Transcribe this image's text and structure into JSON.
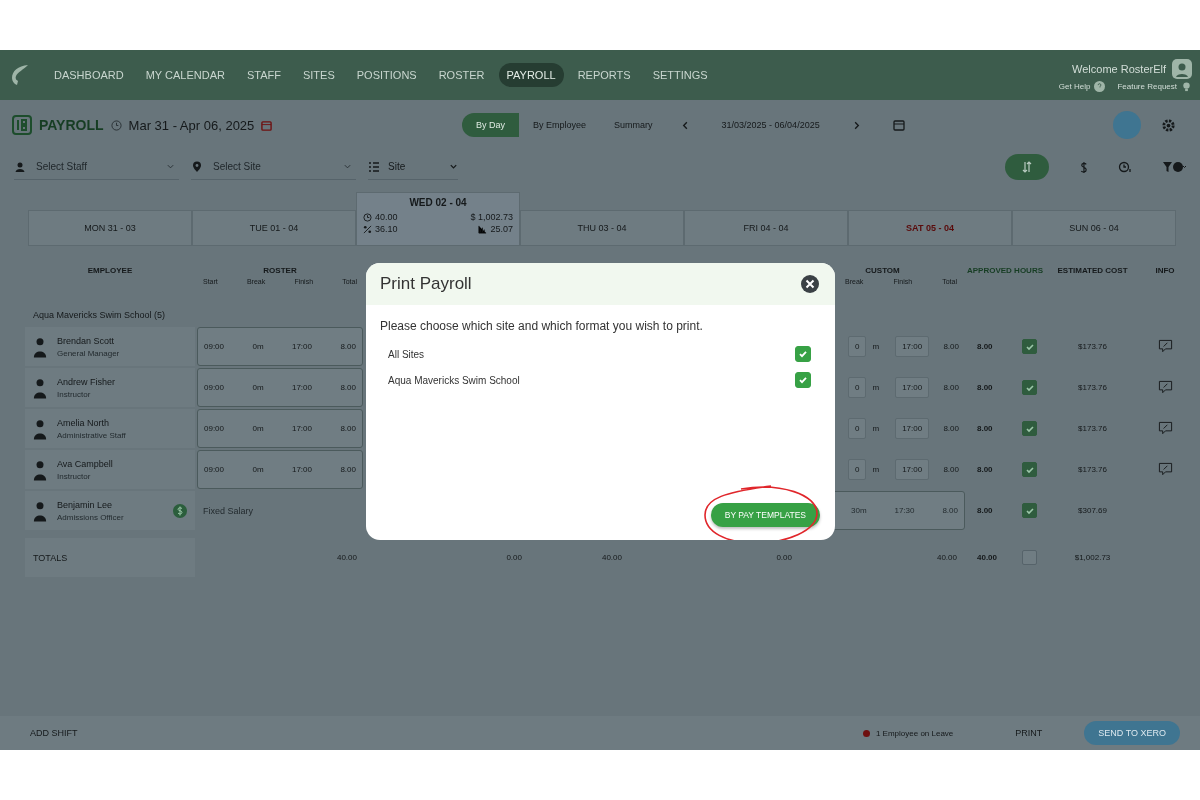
{
  "nav": {
    "items": [
      {
        "label": "DASHBOARD",
        "selected": false
      },
      {
        "label": "MY CALENDAR",
        "selected": false
      },
      {
        "label": "STAFF",
        "selected": false
      },
      {
        "label": "SITES",
        "selected": false
      },
      {
        "label": "POSITIONS",
        "selected": false
      },
      {
        "label": "ROSTER",
        "selected": false
      },
      {
        "label": "PAYROLL",
        "selected": true
      },
      {
        "label": "REPORTS",
        "selected": false
      },
      {
        "label": "SETTINGS",
        "selected": false
      }
    ],
    "welcome": "Welcome RosterElf",
    "help": "Get Help",
    "feature_request": "Feature Request"
  },
  "header": {
    "title": "PAYROLL",
    "date_range": "Mar 31 - Apr 06, 2025",
    "period": "31/03/2025 - 06/04/2025",
    "views": [
      {
        "label": "By Day",
        "selected": true
      },
      {
        "label": "By Employee",
        "selected": false
      },
      {
        "label": "Summary",
        "selected": false
      }
    ]
  },
  "filters": {
    "staff": {
      "placeholder": "Select Staff"
    },
    "site": {
      "placeholder": "Select Site"
    },
    "group_by": "Site"
  },
  "days": [
    {
      "label": "MON 31 - 03",
      "selected": false,
      "flagged": false
    },
    {
      "label": "TUE 01 - 04",
      "selected": false,
      "flagged": false
    },
    {
      "label": "WED 02 - 04",
      "selected": true,
      "flagged": false,
      "stats": {
        "hours": "40.00",
        "cost": "$ 1,002.73",
        "percent": "36.10",
        "ratio": "25.07"
      }
    },
    {
      "label": "THU 03 - 04",
      "selected": false,
      "flagged": false
    },
    {
      "label": "FRI 04 - 04",
      "selected": false,
      "flagged": false
    },
    {
      "label": "SAT 05 - 04",
      "selected": false,
      "flagged": true
    },
    {
      "label": "SUN 06 - 04",
      "selected": false,
      "flagged": false
    }
  ],
  "table": {
    "columns": {
      "employee": "EMPLOYEE",
      "roster": "ROSTER",
      "roster_sub": [
        "Start",
        "Break",
        "Finish",
        "Total"
      ],
      "custom": "CUSTOM",
      "custom_sub": [
        "Break",
        "Finish",
        "Total"
      ],
      "approved": "APPROVED HOURS",
      "cost": "ESTIMATED COST",
      "info": "INFO"
    },
    "group": "Aqua Mavericks Swim School (5)",
    "rows": [
      {
        "name": "Brendan Scott",
        "role": "General Manager",
        "kind": "shift",
        "roster": [
          "09:00",
          "0m",
          "17:00",
          "8.00"
        ],
        "custom": {
          "break": "0",
          "unit": "m",
          "finish": "17:00",
          "total": "8.00"
        },
        "approved": "8.00",
        "checked": true,
        "cost": "$173.76"
      },
      {
        "name": "Andrew Fisher",
        "role": "Instructor",
        "kind": "shift",
        "roster": [
          "09:00",
          "0m",
          "17:00",
          "8.00"
        ],
        "custom": {
          "break": "0",
          "unit": "m",
          "finish": "17:00",
          "total": "8.00"
        },
        "approved": "8.00",
        "checked": true,
        "cost": "$173.76"
      },
      {
        "name": "Amelia North",
        "role": "Administrative Staff",
        "kind": "shift",
        "roster": [
          "09:00",
          "0m",
          "17:00",
          "8.00"
        ],
        "custom": {
          "break": "0",
          "unit": "m",
          "finish": "17:00",
          "total": "8.00"
        },
        "approved": "8.00",
        "checked": true,
        "cost": "$173.76"
      },
      {
        "name": "Ava Campbell",
        "role": "Instructor",
        "kind": "shift",
        "roster": [
          "09:00",
          "0m",
          "17:00",
          "8.00"
        ],
        "custom": {
          "break": "0",
          "unit": "m",
          "finish": "17:00",
          "total": "8.00"
        },
        "approved": "8.00",
        "checked": true,
        "cost": "$173.76"
      },
      {
        "name": "Benjamin Lee",
        "role": "Admissions Officer",
        "kind": "salary",
        "note": "Fixed Salary",
        "custom": {
          "break": "30m",
          "finish": "17:30",
          "total": "8.00"
        },
        "approved": "8.00",
        "checked": true,
        "cost": "$307.69"
      }
    ],
    "totals": {
      "label": "TOTALS",
      "values": [
        "40.00",
        "0.00",
        "40.00",
        "0.00",
        "40.00"
      ],
      "approved": "40.00",
      "checked": false,
      "cost": "$1,002.73"
    }
  },
  "footer": {
    "add_shift": "ADD SHIFT",
    "leave": "1 Employee on Leave",
    "print": "PRINT",
    "send": "SEND TO XERO"
  },
  "modal": {
    "title": "Print Payroll",
    "message": "Please choose which site and which format you wish to print.",
    "options": [
      {
        "label": "All Sites",
        "checked": true
      },
      {
        "label": "Aqua Mavericks Swim School",
        "checked": true
      }
    ],
    "button": {
      "label": "BY PAY TEMPLATES",
      "highlighted": true
    }
  }
}
